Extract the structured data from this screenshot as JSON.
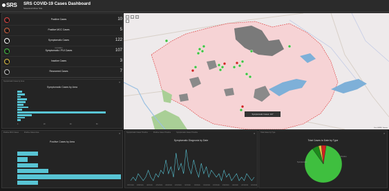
{
  "header": {
    "logo": "SRS",
    "title": "SRS COVID-19 Cases Dashboard",
    "subtitle": "Savannah River Site"
  },
  "indicators": [
    {
      "label": "Positive Cases",
      "sub": "",
      "value": "10",
      "color": "#e04040"
    },
    {
      "label": "Positive MCC Cases",
      "sub": "",
      "value": "5",
      "color": "#d06040"
    },
    {
      "label": "Symptomatic Cases",
      "sub": "",
      "value": "122",
      "color": "#ffffff"
    },
    {
      "label": "Symptomatic / PUI Cases",
      "sub": "cumulative",
      "value": "107",
      "color": "#40c040"
    },
    {
      "label": "Inactive Cases",
      "sub": "",
      "value": "3",
      "color": "#e0c040"
    },
    {
      "label": "Recovered Cases",
      "sub": "",
      "value": "7",
      "color": "#c0c0c0"
    }
  ],
  "symptomatic_panel": {
    "tabs": [
      "Symptomatic Cases by Area"
    ],
    "title": "Symptomatic Cases by Area",
    "x_ticks": [
      "0",
      "20",
      "40",
      "60",
      "80"
    ]
  },
  "positive_panel": {
    "tabs": [
      "Positive MCC Cases",
      "Positive Cases Area"
    ],
    "title": "Positive Cases by Area"
  },
  "timeline_panel": {
    "tabs": [
      "Symptomatic Cases Timeline",
      "Positive Cases Timeline",
      "Symptomatic Cases Timeline"
    ],
    "title": "Symptomatic Diagnosis by Date",
    "x_ticks": [
      "3/21/2020",
      "3/28/2020",
      "4/4/2020",
      "4/11/2020",
      "4/18/2020",
      "4/25/2020",
      "5/2/2020",
      "5/9/2020",
      "5/16/2020",
      "5/23/2020",
      "5/30/2020",
      "6/6/2020",
      "6/13/2020",
      "6/20/2020"
    ]
  },
  "pie_panel": {
    "tabs": [
      "Total Cases by Type"
    ],
    "title": "Total Cases to Date by Type",
    "legend_left": "Symptomatic",
    "legend_right": "Positive"
  },
  "map": {
    "popup_text": "Symptomatic Cases: 107",
    "attribution": "Esri, HERE, Garmin",
    "colors": {
      "county": "#f5d2d4",
      "border": "#e05050",
      "site": "#777777",
      "water": "#7fb0d8"
    }
  },
  "chart_data": [
    {
      "type": "bar",
      "orientation": "horizontal",
      "title": "Symptomatic Cases by Area",
      "categories": [
        "A1",
        "A2",
        "A3",
        "A4",
        "A5",
        "A6",
        "A7",
        "A8",
        "A9",
        "A10",
        "A11",
        "A12"
      ],
      "values": [
        4,
        6,
        3,
        8,
        7,
        5,
        9,
        4,
        72,
        12,
        6,
        3
      ],
      "xlim": [
        0,
        90
      ]
    },
    {
      "type": "bar",
      "orientation": "horizontal",
      "title": "Positive Cases by Area",
      "categories": [
        "B1",
        "B2",
        "B3",
        "B4",
        "B5",
        "B6"
      ],
      "values": [
        2,
        1,
        2,
        3,
        10,
        2
      ],
      "xlim": [
        0,
        10
      ]
    },
    {
      "type": "line",
      "title": "Symptomatic Diagnosis by Date",
      "values": [
        0,
        1,
        0,
        2,
        1,
        0,
        1,
        3,
        1,
        0,
        2,
        1,
        3,
        2,
        6,
        2,
        4,
        1,
        8,
        3,
        5,
        2,
        9,
        4,
        2,
        6,
        3,
        1,
        5,
        2,
        4,
        1,
        3,
        2,
        1,
        2,
        0,
        3,
        1,
        2,
        0,
        1,
        2,
        0,
        1,
        0,
        2,
        1,
        0,
        1
      ],
      "ylim": [
        0,
        10
      ]
    },
    {
      "type": "pie",
      "title": "Total Cases to Date by Type",
      "series": [
        {
          "name": "Symptomatic",
          "value": 107,
          "color": "#3fbf3f"
        },
        {
          "name": "Positive",
          "value": 5,
          "color": "#d02020"
        },
        {
          "name": "Inactive",
          "value": 3,
          "color": "#e0c040"
        },
        {
          "name": "Recovered",
          "value": 7,
          "color": "#1c8a1c"
        }
      ]
    }
  ]
}
